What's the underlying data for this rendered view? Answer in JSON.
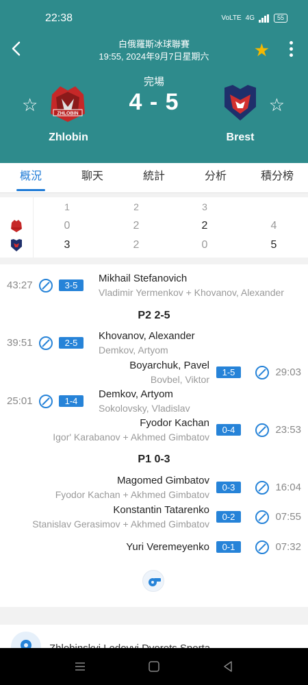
{
  "status_bar": {
    "time": "22:38",
    "battery": "55",
    "network": "4G"
  },
  "header": {
    "league": "白俄羅斯冰球聯賽",
    "datetime": "19:55, 2024年9月7日星期六",
    "match_status": "完場",
    "score": "4 - 5",
    "home_team": "Zhlobin",
    "away_team": "Brest",
    "home_logo_text": "ZHLOBIN",
    "favorite": true
  },
  "tabs": [
    {
      "label": "概況",
      "active": true
    },
    {
      "label": "聊天",
      "active": false
    },
    {
      "label": "統計",
      "active": false
    },
    {
      "label": "分析",
      "active": false
    },
    {
      "label": "積分榜",
      "active": false
    }
  ],
  "periods": {
    "headers": [
      "1",
      "2",
      "3",
      ""
    ],
    "home": [
      "0",
      "2",
      "2",
      "4"
    ],
    "away": [
      "3",
      "2",
      "0",
      "5"
    ]
  },
  "events": [
    {
      "side": "left",
      "time": "43:27",
      "score": "3-5",
      "scorer": "Mikhail Stefanovich",
      "assist": "Vladimir Yermenkov + Khovanov, Alexander"
    },
    {
      "side": "left",
      "time": "39:51",
      "score": "2-5",
      "scorer": "Khovanov, Alexander",
      "assist": "Demkov, Artyom"
    },
    {
      "side": "right",
      "time": "29:03",
      "score": "1-5",
      "scorer": "Boyarchuk, Pavel",
      "assist": "Bovbel, Viktor"
    },
    {
      "side": "left",
      "time": "25:01",
      "score": "1-4",
      "scorer": "Demkov, Artyom",
      "assist": "Sokolovsky, Vladislav"
    },
    {
      "side": "right",
      "time": "23:53",
      "score": "0-4",
      "scorer": "Fyodor Kachan",
      "assist": "Igor' Karabanov + Akhmed Gimbatov"
    },
    {
      "side": "right",
      "time": "16:04",
      "score": "0-3",
      "scorer": "Magomed Gimbatov",
      "assist": "Fyodor Kachan + Akhmed Gimbatov"
    },
    {
      "side": "right",
      "time": "07:55",
      "score": "0-2",
      "scorer": "Konstantin Tatarenko",
      "assist": "Stanislav Gerasimov + Akhmed Gimbatov"
    },
    {
      "side": "right",
      "time": "07:32",
      "score": "0-1",
      "scorer": "Yuri Veremeyenko",
      "assist": ""
    }
  ],
  "period_labels": {
    "p2": "P2 2-5",
    "p1": "P1 0-3"
  },
  "venue": {
    "name": "Zhlobinskyi Ledovyi Dvorets Sporta"
  },
  "icons": {
    "back": "back-arrow-icon",
    "favorite": "star-filled-icon",
    "more": "more-vertical-icon",
    "goal": "hockey-stick-icon",
    "whistle": "whistle-icon",
    "venue": "location-pin-icon"
  },
  "colors": {
    "header_bg": "#2e8b8c",
    "accent": "#1e7ad6",
    "badge": "#2683d8",
    "star": "#f5b800"
  }
}
